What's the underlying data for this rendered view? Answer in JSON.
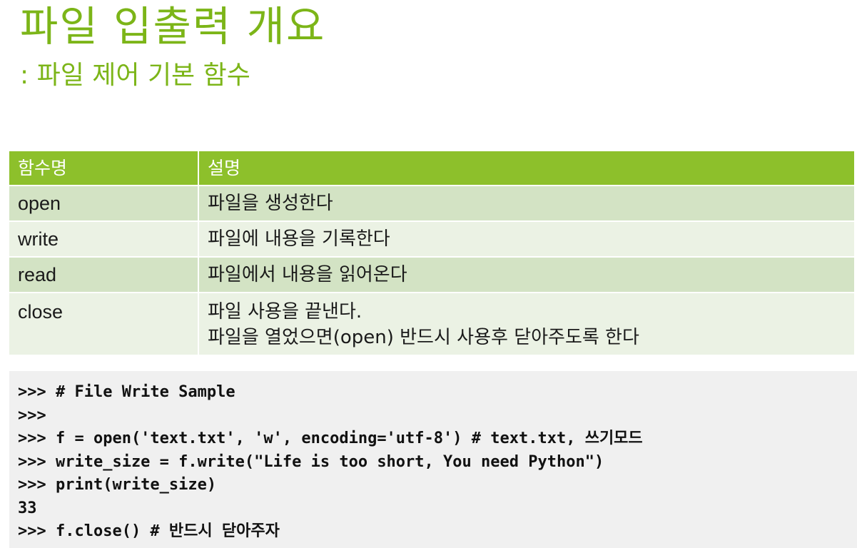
{
  "title": "파일 입출력 개요",
  "subtitle": ": 파일 제어 기본 함수",
  "table": {
    "headers": [
      "함수명",
      "설명"
    ],
    "rows": [
      {
        "name": "open",
        "desc": [
          "파일을 생성한다"
        ]
      },
      {
        "name": "write",
        "desc": [
          "파일에 내용을 기록한다"
        ]
      },
      {
        "name": "read",
        "desc": [
          "파일에서 내용을 읽어온다"
        ]
      },
      {
        "name": "close",
        "desc": [
          "파일 사용을 끝낸다.",
          "파일을 열었으면(open) 반드시 사용후 닫아주도록 한다"
        ]
      }
    ]
  },
  "code": {
    "lines": [
      ">>> # File Write Sample",
      ">>>",
      ">>> f = open('text.txt', 'w', encoding='utf-8') # text.txt, 쓰기모드",
      ">>> write_size = f.write(\"Life is too short, You need Python\")",
      ">>> print(write_size)",
      "33",
      ">>> f.close() # 반드시 닫아주자"
    ]
  },
  "colors": {
    "title": "#7cb518",
    "header_bg": "#8dc02b",
    "row_dark": "#d3e3c4",
    "row_light": "#ebf2e4",
    "code_bg": "#f0f0f0"
  }
}
